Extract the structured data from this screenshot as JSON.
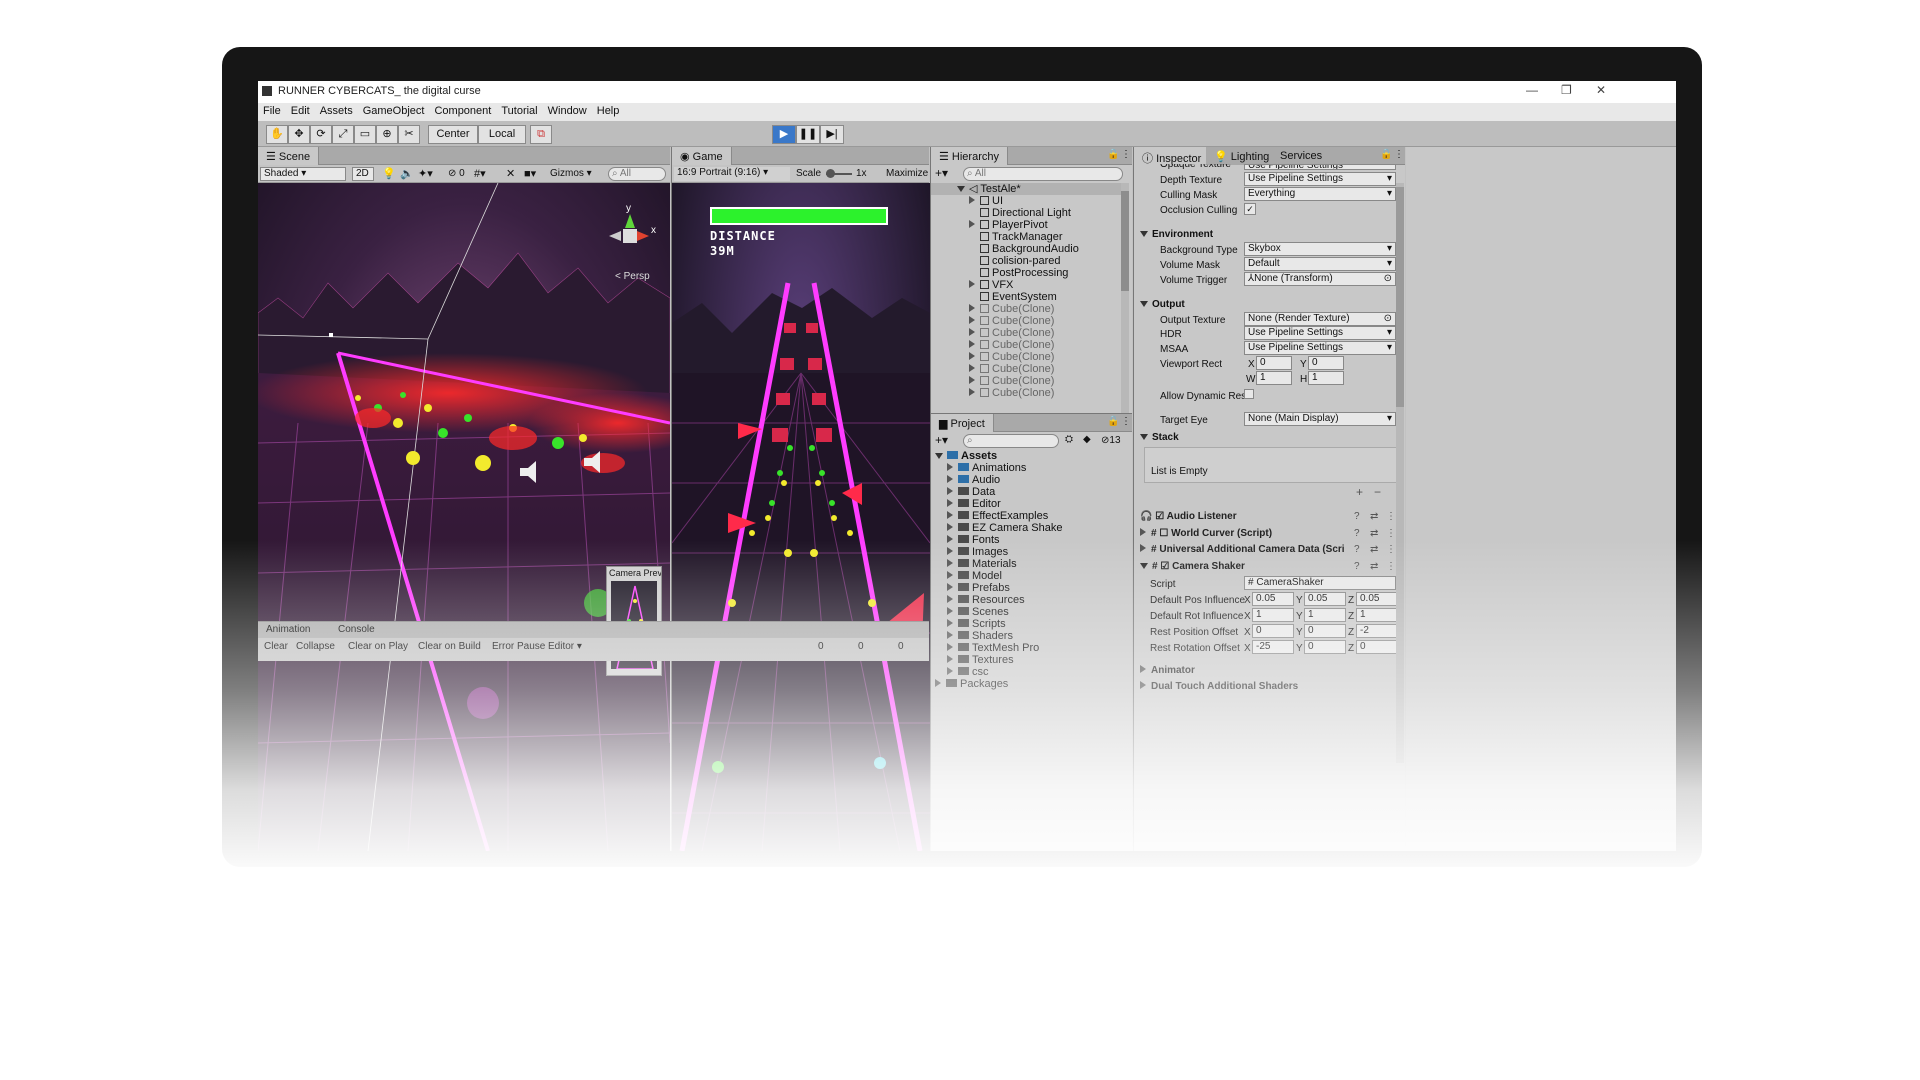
{
  "window": {
    "title": "RUNNER CYBERCATS_ the digital curse",
    "controls": {
      "minimize": "—",
      "maximize": "❐",
      "close": "✕"
    }
  },
  "menu": [
    "File",
    "Edit",
    "Assets",
    "GameObject",
    "Component",
    "Tutorial",
    "Window",
    "Help"
  ],
  "toolbar": {
    "center_label": "Center",
    "local_label": "Local",
    "play_icon": "play-icon",
    "pause_icon": "pause-icon",
    "step_icon": "step-icon"
  },
  "scene": {
    "tab": "Scene",
    "shading": "Shaded",
    "mode_2d": "2D",
    "fx_count": "0",
    "gizmos": "Gizmos",
    "search_placeholder": "All",
    "persp_label": "< Persp",
    "gizmo_axes": {
      "y": "y",
      "x": "x"
    },
    "camera_preview": "Camera Preview"
  },
  "game": {
    "tab": "Game",
    "aspect": "16:9 Portrait (9:16)",
    "scale_label": "Scale",
    "scale_value": "1x",
    "maximize": "Maximize",
    "hud_distance_label": "DISTANCE",
    "hud_distance_value": "39M",
    "health": 1.0
  },
  "hierarchy": {
    "tab": "Hierarchy",
    "search_placeholder": "All",
    "root": "TestAle*",
    "items": [
      "UI",
      "Directional Light",
      "PlayerPivot",
      "TrackManager",
      "BackgroundAudio",
      "colision-pared",
      "PostProcessing",
      "VFX",
      "EventSystem",
      "Cube(Clone)",
      "Cube(Clone)",
      "Cube(Clone)",
      "Cube(Clone)",
      "Cube(Clone)",
      "Cube(Clone)",
      "Cube(Clone)",
      "Cube(Clone)"
    ]
  },
  "project": {
    "tab": "Project",
    "hidden_count": "13",
    "root": "Assets",
    "folders": [
      "Animations",
      "Audio",
      "Data",
      "Editor",
      "EffectExamples",
      "EZ Camera Shake",
      "Fonts",
      "Images",
      "Materials",
      "Model",
      "Prefabs",
      "Resources",
      "Scenes",
      "Scripts",
      "Shaders",
      "TextMesh Pro",
      "Textures",
      "csc"
    ],
    "packages": "Packages"
  },
  "console": {
    "tabs": [
      "Animation",
      "Console"
    ],
    "buttons": [
      "Clear",
      "Collapse",
      "Clear on Play",
      "Clear on Build",
      "Error Pause",
      "Editor ▾"
    ],
    "counts": [
      "0",
      "0",
      "0"
    ]
  },
  "inspector": {
    "tabs": [
      "Inspector",
      "Lighting",
      "Services"
    ],
    "partial_top": "Opaque Texture",
    "partial_top_value": "Use Pipeline Settings",
    "rows": [
      {
        "label": "Depth Texture",
        "value": "Use Pipeline Settings"
      },
      {
        "label": "Culling Mask",
        "value": "Everything"
      },
      {
        "label": "Occlusion Culling",
        "value": "✓"
      }
    ],
    "environment": {
      "header": "Environment",
      "rows": [
        {
          "label": "Background Type",
          "value": "Skybox"
        },
        {
          "label": "Volume Mask",
          "value": "Default"
        },
        {
          "label": "Volume Trigger",
          "value": "None (Transform)"
        }
      ]
    },
    "output": {
      "header": "Output",
      "rows": [
        {
          "label": "Output Texture",
          "value": "None (Render Texture)"
        },
        {
          "label": "HDR",
          "value": "Use Pipeline Settings"
        },
        {
          "label": "MSAA",
          "value": "Use Pipeline Settings"
        }
      ],
      "viewport_label": "Viewport Rect",
      "viewport": {
        "x_label": "X",
        "x": "0",
        "y_label": "Y",
        "y": "0",
        "w_label": "W",
        "w": "1",
        "h_label": "H",
        "h": "1"
      },
      "allow_dynamic": "Allow Dynamic Res",
      "target_eye_label": "Target Eye",
      "target_eye": "None (Main Display)"
    },
    "stack": {
      "header": "Stack",
      "empty": "List is Empty"
    },
    "components": [
      "Audio Listener",
      "World Curver (Script)",
      "Universal Additional Camera Data (Scri",
      "Camera Shaker"
    ],
    "shaker": {
      "script_label": "Script",
      "script_value": "CameraShaker",
      "pos_label": "Default Pos Influence",
      "pos": [
        "0.05",
        "0.05",
        "0.05"
      ],
      "rot_label": "Default Rot Influence",
      "rot": [
        "1",
        "1",
        "1"
      ],
      "rest_pos_label": "Rest Position Offset",
      "rest_pos": [
        "0",
        "0",
        "-2"
      ],
      "rest_rot_label": "Rest Rotation Offset",
      "rest_rot": [
        "-25",
        "0",
        "0"
      ]
    },
    "extra_components": [
      "Animator",
      "Dual Touch Additional Shaders"
    ]
  }
}
